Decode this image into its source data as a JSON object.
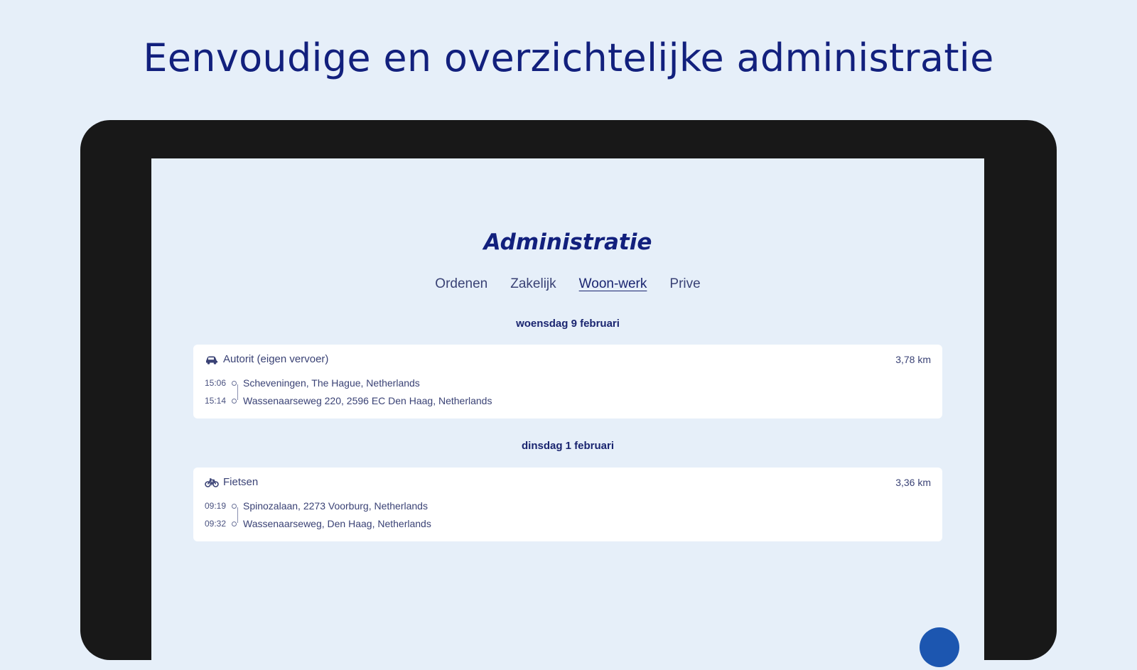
{
  "headline": "Eenvoudige en overzichtelijke administratie",
  "screen": {
    "title": "Administratie",
    "tabs": [
      {
        "label": "Ordenen",
        "active": false
      },
      {
        "label": "Zakelijk",
        "active": false
      },
      {
        "label": "Woon-werk",
        "active": true
      },
      {
        "label": "Prive",
        "active": false
      }
    ],
    "groups": [
      {
        "date": "woensdag 9 februari",
        "trips": [
          {
            "icon": "car-icon",
            "type": "Autorit (eigen vervoer)",
            "distance": "3,78 km",
            "stops": [
              {
                "time": "15:06",
                "address": "Scheveningen, The Hague, Netherlands"
              },
              {
                "time": "15:14",
                "address": "Wassenaarseweg 220, 2596 EC Den Haag, Netherlands"
              }
            ]
          }
        ]
      },
      {
        "date": "dinsdag 1 februari",
        "trips": [
          {
            "icon": "bicycle-icon",
            "type": "Fietsen",
            "distance": "3,36 km",
            "stops": [
              {
                "time": "09:19",
                "address": "Spinozalaan, 2273 Voorburg, Netherlands"
              },
              {
                "time": "09:32",
                "address": "Wassenaarseweg, Den Haag, Netherlands"
              }
            ]
          }
        ]
      }
    ]
  },
  "colors": {
    "background": "#e6eff9",
    "device_frame": "#181818",
    "headline": "#12207d",
    "fab": "#1c56b0"
  }
}
